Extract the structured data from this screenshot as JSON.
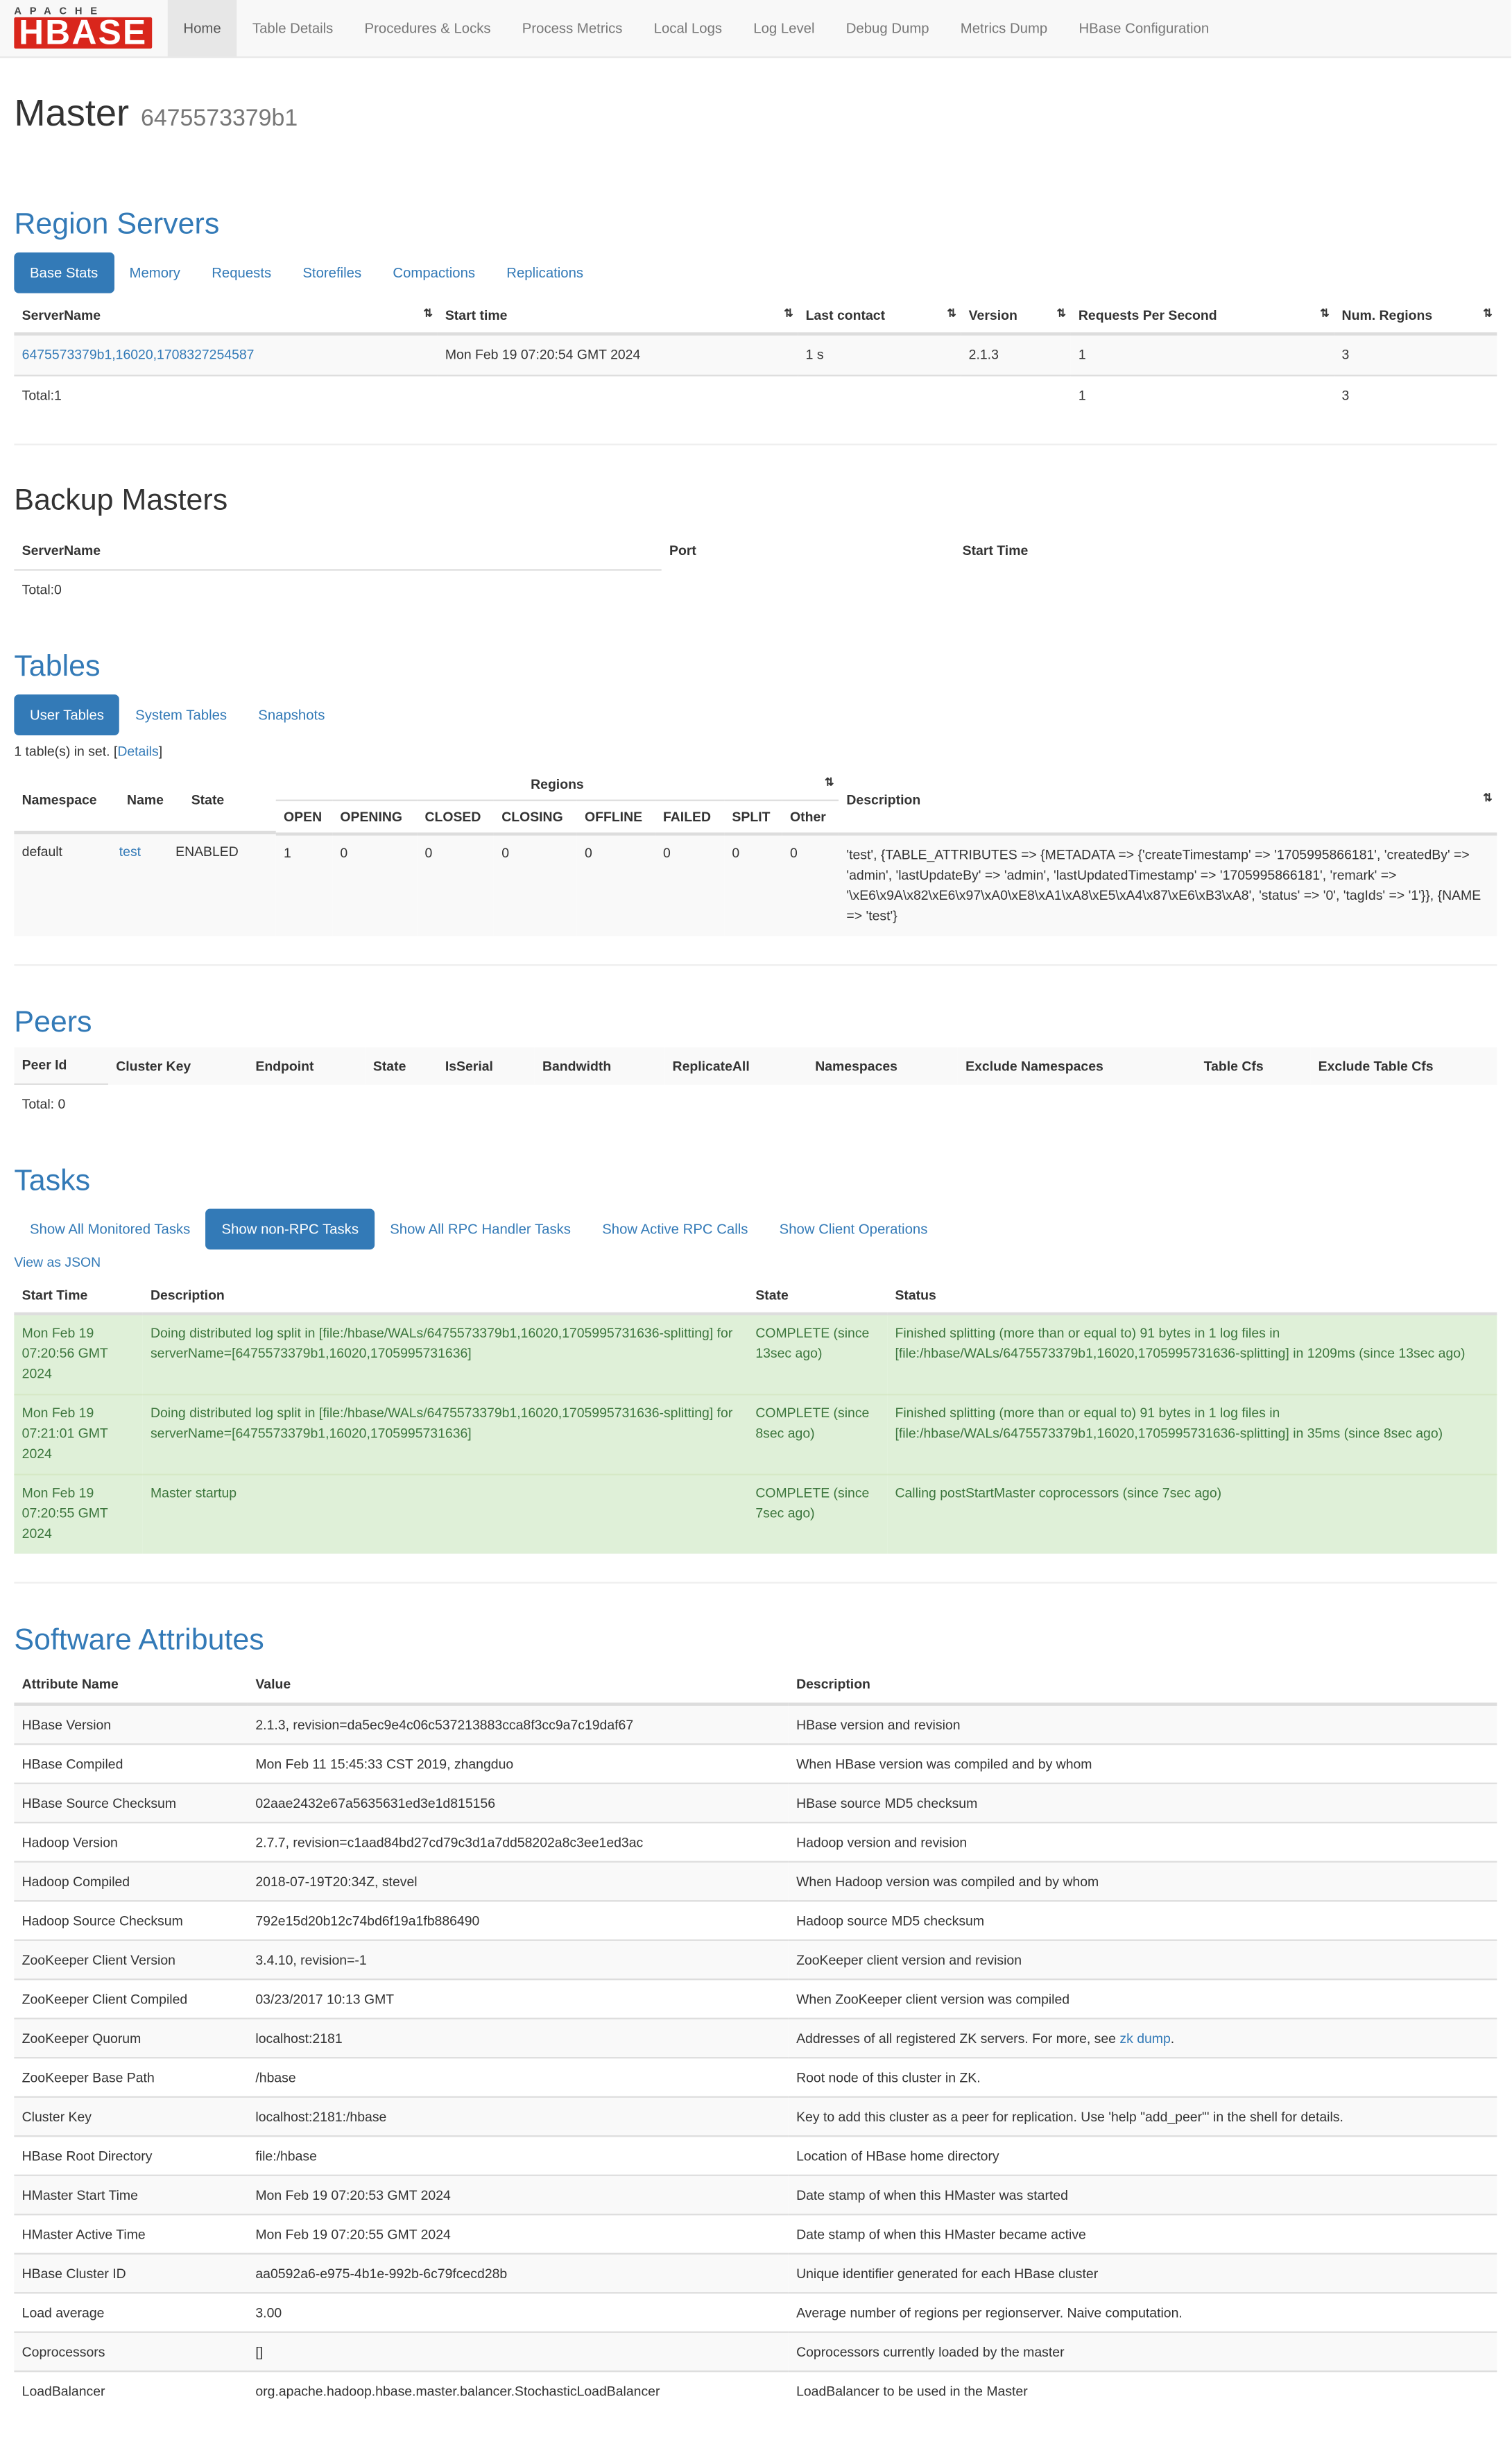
{
  "nav": {
    "logo_apache": "APACHE",
    "logo_hbase": "HBASE",
    "items": [
      "Home",
      "Table Details",
      "Procedures & Locks",
      "Process Metrics",
      "Local Logs",
      "Log Level",
      "Debug Dump",
      "Metrics Dump",
      "HBase Configuration"
    ]
  },
  "header": {
    "title": "Master",
    "host": "6475573379b1"
  },
  "region_servers": {
    "title": "Region Servers",
    "tabs": [
      "Base Stats",
      "Memory",
      "Requests",
      "Storefiles",
      "Compactions",
      "Replications"
    ],
    "columns": [
      "ServerName",
      "Start time",
      "Last contact",
      "Version",
      "Requests Per Second",
      "Num. Regions"
    ],
    "row": [
      "6475573379b1,16020,1708327254587",
      "Mon Feb 19 07:20:54 GMT 2024",
      "1 s",
      "2.1.3",
      "1",
      "3"
    ],
    "total": {
      "label": "Total:1",
      "rps": "1",
      "regions": "3"
    }
  },
  "backup_masters": {
    "title": "Backup Masters",
    "columns": [
      "ServerName",
      "Port",
      "Start Time"
    ],
    "total": "Total:0"
  },
  "tables": {
    "title": "Tables",
    "tabs": [
      "User Tables",
      "System Tables",
      "Snapshots"
    ],
    "count_text": "1 table(s) in set. [",
    "details_link": "Details",
    "count_close": "]",
    "regions_header": "Regions",
    "columns": [
      "Namespace",
      "Name",
      "State",
      "OPEN",
      "OPENING",
      "CLOSED",
      "CLOSING",
      "OFFLINE",
      "FAILED",
      "SPLIT",
      "Other",
      "Description"
    ],
    "row": {
      "namespace": "default",
      "name": "test",
      "state": "ENABLED",
      "open": "1",
      "opening": "0",
      "closed": "0",
      "closing": "0",
      "offline": "0",
      "failed": "0",
      "split": "0",
      "other": "0",
      "description": "'test', {TABLE_ATTRIBUTES => {METADATA => {'createTimestamp' => '1705995866181', 'createdBy' => 'admin', 'lastUpdateBy' => 'admin', 'lastUpdatedTimestamp' => '1705995866181', 'remark' => '\\xE6\\x9A\\x82\\xE6\\x97\\xA0\\xE8\\xA1\\xA8\\xE5\\xA4\\x87\\xE6\\xB3\\xA8', 'status' => '0', 'tagIds' => '1'}}, {NAME => 'test'}"
    }
  },
  "peers": {
    "title": "Peers",
    "columns": [
      "Peer Id",
      "Cluster Key",
      "Endpoint",
      "State",
      "IsSerial",
      "Bandwidth",
      "ReplicateAll",
      "Namespaces",
      "Exclude Namespaces",
      "Table Cfs",
      "Exclude Table Cfs"
    ],
    "total": "Total: 0"
  },
  "tasks": {
    "title": "Tasks",
    "tabs": [
      "Show All Monitored Tasks",
      "Show non-RPC Tasks",
      "Show All RPC Handler Tasks",
      "Show Active RPC Calls",
      "Show Client Operations"
    ],
    "view_json": "View as JSON",
    "columns": [
      "Start Time",
      "Description",
      "State",
      "Status"
    ],
    "rows": [
      {
        "start": "Mon Feb 19 07:20:56 GMT 2024",
        "description": "Doing distributed log split in [file:/hbase/WALs/6475573379b1,16020,1705995731636-splitting] for serverName=[6475573379b1,16020,1705995731636]",
        "state": "COMPLETE (since 13sec ago)",
        "status": "Finished splitting (more than or equal to) 91 bytes in 1 log files in [file:/hbase/WALs/6475573379b1,16020,1705995731636-splitting] in 1209ms (since 13sec ago)"
      },
      {
        "start": "Mon Feb 19 07:21:01 GMT 2024",
        "description": "Doing distributed log split in [file:/hbase/WALs/6475573379b1,16020,1705995731636-splitting] for serverName=[6475573379b1,16020,1705995731636]",
        "state": "COMPLETE (since 8sec ago)",
        "status": "Finished splitting (more than or equal to) 91 bytes in 1 log files in [file:/hbase/WALs/6475573379b1,16020,1705995731636-splitting] in 35ms (since 8sec ago)"
      },
      {
        "start": "Mon Feb 19 07:20:55 GMT 2024",
        "description": "Master startup",
        "state": "COMPLETE (since 7sec ago)",
        "status": "Calling postStartMaster coprocessors (since 7sec ago)"
      }
    ]
  },
  "software": {
    "title": "Software Attributes",
    "columns": [
      "Attribute Name",
      "Value",
      "Description"
    ],
    "rows": [
      [
        "HBase Version",
        "2.1.3, revision=da5ec9e4c06c537213883cca8f3cc9a7c19daf67",
        "HBase version and revision"
      ],
      [
        "HBase Compiled",
        "Mon Feb 11 15:45:33 CST 2019, zhangduo",
        "When HBase version was compiled and by whom"
      ],
      [
        "HBase Source Checksum",
        "02aae2432e67a5635631ed3e1d815156",
        "HBase source MD5 checksum"
      ],
      [
        "Hadoop Version",
        "2.7.7, revision=c1aad84bd27cd79c3d1a7dd58202a8c3ee1ed3ac",
        "Hadoop version and revision"
      ],
      [
        "Hadoop Compiled",
        "2018-07-19T20:34Z, stevel",
        "When Hadoop version was compiled and by whom"
      ],
      [
        "Hadoop Source Checksum",
        "792e15d20b12c74bd6f19a1fb886490",
        "Hadoop source MD5 checksum"
      ],
      [
        "ZooKeeper Client Version",
        "3.4.10, revision=-1",
        "ZooKeeper client version and revision"
      ],
      [
        "ZooKeeper Client Compiled",
        "03/23/2017 10:13 GMT",
        "When ZooKeeper client version was compiled"
      ],
      [
        "ZooKeeper Quorum",
        "localhost:2181",
        "Addresses of all registered ZK servers. For more, see "
      ],
      [
        "ZooKeeper Base Path",
        "/hbase",
        "Root node of this cluster in ZK."
      ],
      [
        "Cluster Key",
        "localhost:2181:/hbase",
        "Key to add this cluster as a peer for replication. Use 'help \"add_peer\"' in the shell for details."
      ],
      [
        "HBase Root Directory",
        "file:/hbase",
        "Location of HBase home directory"
      ],
      [
        "HMaster Start Time",
        "Mon Feb 19 07:20:53 GMT 2024",
        "Date stamp of when this HMaster was started"
      ],
      [
        "HMaster Active Time",
        "Mon Feb 19 07:20:55 GMT 2024",
        "Date stamp of when this HMaster became active"
      ],
      [
        "HBase Cluster ID",
        "aa0592a6-e975-4b1e-992b-6c79fcecd28b",
        "Unique identifier generated for each HBase cluster"
      ],
      [
        "Load average",
        "3.00",
        "Average number of regions per regionserver. Naive computation."
      ],
      [
        "Coprocessors",
        "[]",
        "Coprocessors currently loaded by the master"
      ],
      [
        "LoadBalancer",
        "org.apache.hadoop.hbase.master.balancer.StochasticLoadBalancer",
        "LoadBalancer to be used in the Master"
      ]
    ],
    "zk_link": "zk dump",
    "zk_link_suffix": "."
  }
}
